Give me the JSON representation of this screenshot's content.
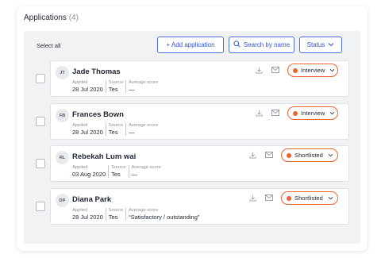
{
  "header": {
    "title": "Applications",
    "count": "(4)"
  },
  "toolbar": {
    "select_all_label": "Select all",
    "add_label": "+ Add application",
    "search_label": "Search by name",
    "status_label": "Status",
    "search_icon": "search-icon",
    "status_icon": "chevron-down-icon"
  },
  "labels": {
    "applied": "Applied",
    "source": "Source",
    "average_score": "Average score"
  },
  "colors": {
    "accent": "#2f55d4",
    "status": "#e8652f"
  },
  "applications": [
    {
      "initials": "JT",
      "name": "Jade Thomas",
      "applied": "28 Jul 2020",
      "source": "Tes",
      "score": "—",
      "status": "Interview"
    },
    {
      "initials": "FB",
      "name": "Frances Bown",
      "applied": "28 Jul 2020",
      "source": "Tes",
      "score": "—",
      "status": "Interview"
    },
    {
      "initials": "RL",
      "name": "Rebekah Lum wai",
      "applied": "03 Aug 2020",
      "source": "Tes",
      "score": "—",
      "status": "Shortlisted"
    },
    {
      "initials": "DP",
      "name": "Diana Park",
      "applied": "28 Jul 2020",
      "source": "Tes",
      "score": "“Satisfactory / outstanding”",
      "status": "Shortlisted"
    }
  ]
}
